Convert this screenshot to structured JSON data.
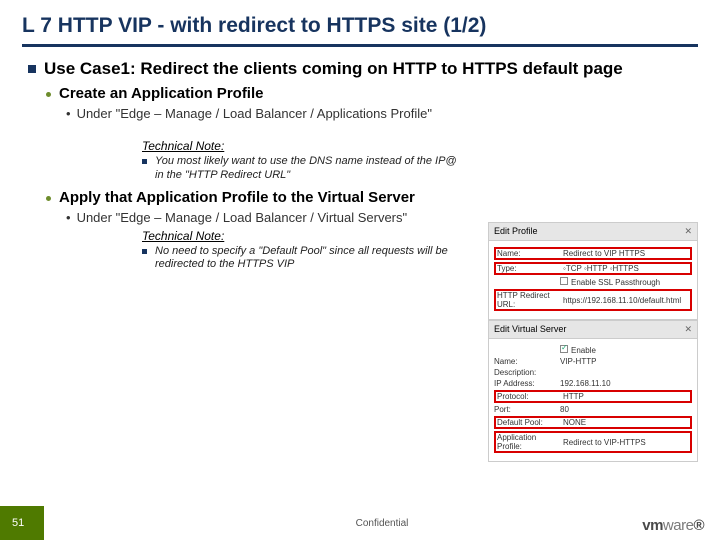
{
  "title": "L 7 HTTP VIP - with redirect to HTTPS site (1/2)",
  "b1": "Use Case1: Redirect the clients coming on HTTP to HTTPS default page",
  "b2a": "Create an Application Profile",
  "b3a": "Under \"Edge – Manage /  Load Balancer / Applications Profile\"",
  "tech1_label": "Technical Note:",
  "tech1_text": "You most likely want to use the DNS name instead of the IP@ in the \"HTTP Redirect URL\"",
  "b2b": "Apply that Application Profile to the Virtual Server",
  "b3b": "Under \"Edge – Manage /  Load Balancer / Virtual Servers\"",
  "tech2_label": "Technical Note:",
  "tech2_text": "No need to specify a \"Default Pool\" since all requests will be redirected to the HTTPS VIP",
  "ep": {
    "title": "Edit Profile",
    "name_label": "Name:",
    "name_val": "Redirect to VIP HTTPS",
    "type_label": "Type:",
    "type_opts": "◦TCP ◦HTTP ◦HTTPS",
    "ssl_label": "",
    "ssl_text": "Enable SSL Passthrough",
    "redir_label": "HTTP Redirect URL:",
    "redir_val": "https://192.168.11.10/default.html"
  },
  "vs": {
    "title": "Edit Virtual Server",
    "enable": "Enable",
    "name_l": "Name:",
    "name_v": "VIP-HTTP",
    "desc_l": "Description:",
    "desc_v": "",
    "ip_l": "IP Address:",
    "ip_v": "192.168.11.10",
    "proto_l": "Protocol:",
    "proto_v": "HTTP",
    "port_l": "Port:",
    "port_v": "80",
    "pool_l": "Default Pool:",
    "pool_v": "NONE",
    "app_l": "Application Profile:",
    "app_v": "Redirect to VIP-HTTPS"
  },
  "footer": {
    "page": "51",
    "conf": "Confidential",
    "brand1": "vm",
    "brand2": "ware"
  }
}
